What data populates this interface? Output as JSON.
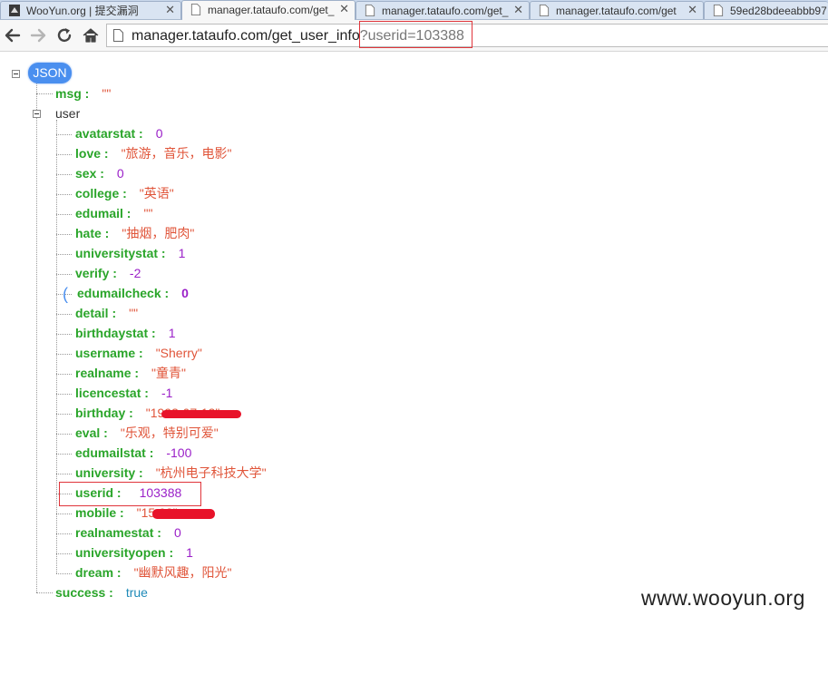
{
  "tabs": [
    {
      "title": "WooYun.org | 提交漏洞",
      "active": false,
      "favicon": "wooyun-logo-icon"
    },
    {
      "title": "manager.tataufo.com/get_",
      "active": true,
      "favicon": "page-icon"
    },
    {
      "title": "manager.tataufo.com/get_",
      "active": false,
      "favicon": "page-icon"
    },
    {
      "title": "manager.tataufo.com/get",
      "active": false,
      "favicon": "page-icon"
    },
    {
      "title": "59ed28bdeeabbb97",
      "active": false,
      "favicon": "page-icon"
    }
  ],
  "toolbar": {
    "back_icon": "back-arrow-icon",
    "forward_icon": "forward-arrow-icon",
    "reload_icon": "reload-icon",
    "home_icon": "home-icon",
    "url_path": "manager.tataufo.com/get_user_info",
    "url_query": "?userid=103388"
  },
  "json_view": {
    "root_label": "JSON",
    "msg": {
      "key": "msg :",
      "value": "\"\""
    },
    "user_label": "user",
    "fields": [
      {
        "key": "avatarstat :",
        "value": "0",
        "type": "num"
      },
      {
        "key": "love :",
        "value": "\"旅游，音乐，电影\"",
        "type": "str"
      },
      {
        "key": "sex :",
        "value": "0",
        "type": "num"
      },
      {
        "key": "college :",
        "value": "\"英语\"",
        "type": "str"
      },
      {
        "key": "edumail :",
        "value": "\"\"",
        "type": "str"
      },
      {
        "key": "hate :",
        "value": "\"抽烟，肥肉\"",
        "type": "str"
      },
      {
        "key": "universitystat :",
        "value": "1",
        "type": "num"
      },
      {
        "key": "verify :",
        "value": "-2",
        "type": "num"
      },
      {
        "key": "edumailcheck :",
        "value": "0",
        "type": "num"
      },
      {
        "key": "detail :",
        "value": "\"\"",
        "type": "str"
      },
      {
        "key": "birthdaystat :",
        "value": "1",
        "type": "num"
      },
      {
        "key": "username :",
        "value": "\"Sherry\"",
        "type": "str"
      },
      {
        "key": "realname :",
        "value": "\"童青\"",
        "type": "str"
      },
      {
        "key": "licencestat :",
        "value": "-1",
        "type": "num"
      },
      {
        "key": "birthday :",
        "value": "\"1993-07-13\"",
        "type": "str"
      },
      {
        "key": "eval :",
        "value": "\"乐观，特别可爱\"",
        "type": "str"
      },
      {
        "key": "edumailstat :",
        "value": "-100",
        "type": "num"
      },
      {
        "key": "university :",
        "value": "\"杭州电子科技大学\"",
        "type": "str"
      },
      {
        "key": "userid :",
        "value": "103388",
        "type": "num"
      },
      {
        "key": "mobile :",
        "value": "\"15          93\"",
        "type": "str"
      },
      {
        "key": "realnamestat :",
        "value": "0",
        "type": "num"
      },
      {
        "key": "universityopen :",
        "value": "1",
        "type": "num"
      },
      {
        "key": "dream :",
        "value": "\"幽默风趣，阳光\"",
        "type": "str"
      }
    ],
    "success": {
      "key": "success :",
      "value": "true"
    }
  },
  "watermark": "www.wooyun.org",
  "colors": {
    "key": "#2aa52a",
    "string": "#e0553a",
    "number": "#9a1fc8",
    "bool": "#1f8ab8",
    "root_badge": "#4a8fef",
    "highlight": "#e0343a",
    "redaction": "#e8132a"
  }
}
